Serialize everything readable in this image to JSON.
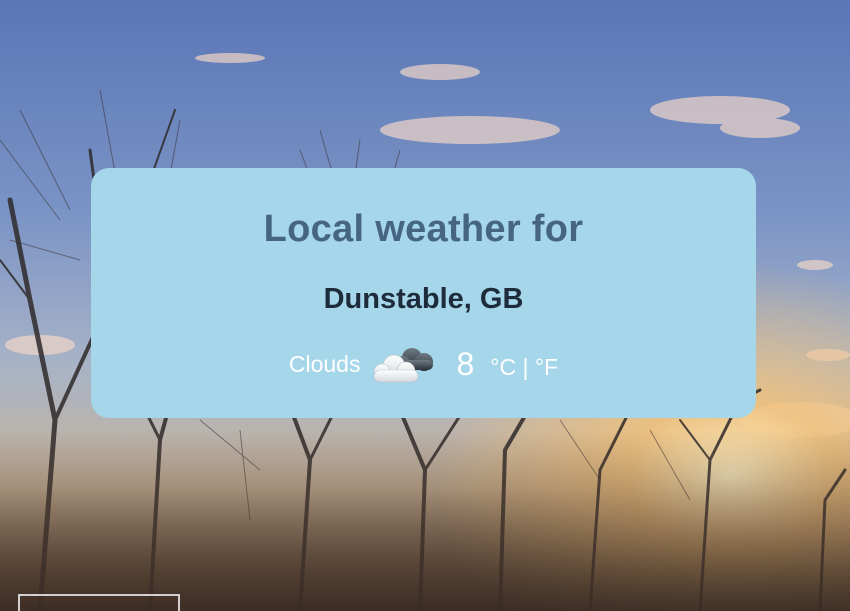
{
  "card": {
    "heading": "Local weather for",
    "location": "Dunstable, GB"
  },
  "weather": {
    "description": "Clouds",
    "icon": "cloud-icon",
    "temperature": "8",
    "unit_c": "°C",
    "separator": "|",
    "unit_f": "°F"
  },
  "colors": {
    "card_background": "#a5d6ea",
    "heading": "#466583",
    "location": "#1d2b3a",
    "conditions_text": "#ffffff"
  }
}
